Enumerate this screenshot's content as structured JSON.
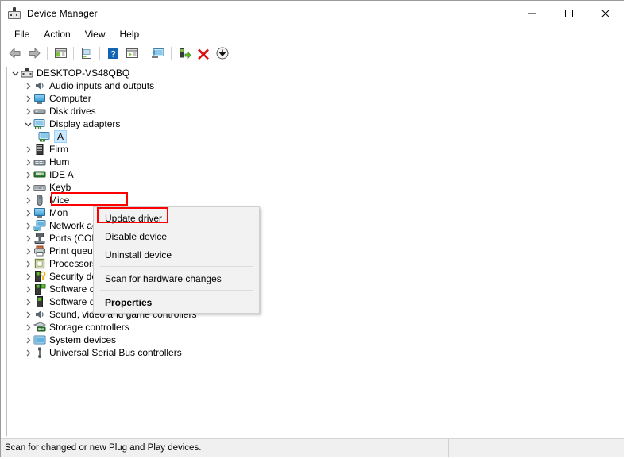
{
  "window": {
    "title": "Device Manager",
    "icon": "device-manager-icon",
    "controls": {
      "minimize": "minimize-icon",
      "maximize": "maximize-icon",
      "close": "close-icon"
    }
  },
  "menubar": {
    "items": [
      {
        "label": "File"
      },
      {
        "label": "Action"
      },
      {
        "label": "View"
      },
      {
        "label": "Help"
      }
    ]
  },
  "toolbar": {
    "buttons": [
      {
        "name": "back-icon"
      },
      {
        "name": "forward-icon"
      },
      {
        "name": "separator"
      },
      {
        "name": "show-hide-console-tree-icon"
      },
      {
        "name": "separator"
      },
      {
        "name": "properties-icon"
      },
      {
        "name": "separator"
      },
      {
        "name": "help-icon"
      },
      {
        "name": "update-driver-icon"
      },
      {
        "name": "separator2"
      },
      {
        "name": "scan-for-hardware-changes-icon"
      },
      {
        "name": "separator"
      },
      {
        "name": "enable-device-icon"
      },
      {
        "name": "uninstall-device-icon"
      },
      {
        "name": "install-legacy-hardware-icon"
      }
    ]
  },
  "tree": {
    "root": {
      "label": "DESKTOP-VS48QBQ",
      "icon": "computer-root-icon",
      "expanded": true
    },
    "items": [
      {
        "label": "Audio inputs and outputs",
        "icon": "speaker-icon",
        "expanded": false,
        "indent": 1
      },
      {
        "label": "Computer",
        "icon": "monitor-icon",
        "expanded": false,
        "indent": 1
      },
      {
        "label": "Disk drives",
        "icon": "disk-icon",
        "expanded": false,
        "indent": 1
      },
      {
        "label": "Display adapters",
        "icon": "display-adapter-icon",
        "expanded": true,
        "indent": 1,
        "highlighted": true
      },
      {
        "label": "A",
        "icon": "display-adapter-icon",
        "expanded": null,
        "indent": 2,
        "selected": true,
        "truncated": true
      },
      {
        "label": "Firm",
        "icon": "firmware-icon",
        "expanded": false,
        "indent": 1,
        "truncated": true
      },
      {
        "label": "Hum",
        "icon": "hid-icon",
        "expanded": false,
        "indent": 1,
        "truncated": true
      },
      {
        "label": "IDE A",
        "icon": "ide-icon",
        "expanded": false,
        "indent": 1,
        "truncated": true
      },
      {
        "label": "Keyb",
        "icon": "keyboard-icon",
        "expanded": false,
        "indent": 1,
        "truncated": true
      },
      {
        "label": "Mice",
        "icon": "mouse-icon",
        "expanded": false,
        "indent": 1,
        "truncated": true
      },
      {
        "label": "Mon",
        "icon": "monitor-icon",
        "expanded": false,
        "indent": 1,
        "truncated": true
      },
      {
        "label": "Network adapters",
        "icon": "network-icon",
        "expanded": false,
        "indent": 1
      },
      {
        "label": "Ports (COM & LPT)",
        "icon": "port-icon",
        "expanded": false,
        "indent": 1
      },
      {
        "label": "Print queues",
        "icon": "printer-icon",
        "expanded": false,
        "indent": 1
      },
      {
        "label": "Processors",
        "icon": "processor-icon",
        "expanded": false,
        "indent": 1
      },
      {
        "label": "Security devices",
        "icon": "security-icon",
        "expanded": false,
        "indent": 1
      },
      {
        "label": "Software components",
        "icon": "software-component-icon",
        "expanded": false,
        "indent": 1
      },
      {
        "label": "Software devices",
        "icon": "software-device-icon",
        "expanded": false,
        "indent": 1
      },
      {
        "label": "Sound, video and game controllers",
        "icon": "speaker-icon",
        "expanded": false,
        "indent": 1
      },
      {
        "label": "Storage controllers",
        "icon": "storage-icon",
        "expanded": false,
        "indent": 1
      },
      {
        "label": "System devices",
        "icon": "system-icon",
        "expanded": false,
        "indent": 1
      },
      {
        "label": "Universal Serial Bus controllers",
        "icon": "usb-icon",
        "expanded": false,
        "indent": 1
      }
    ]
  },
  "context_menu": {
    "items": [
      {
        "label": "Update driver",
        "bold": false,
        "highlighted": true
      },
      {
        "label": "Disable device",
        "bold": false
      },
      {
        "label": "Uninstall device",
        "bold": false
      },
      {
        "separator": true
      },
      {
        "label": "Scan for hardware changes",
        "bold": false
      },
      {
        "separator": true
      },
      {
        "label": "Properties",
        "bold": true
      }
    ]
  },
  "statusbar": {
    "text": "Scan for changed or new Plug and Play devices."
  },
  "colors": {
    "highlight_red": "#ff0000",
    "selection_blue": "#cce8ff",
    "menu_bg": "#f2f2f2",
    "statusbar_bg": "#f0f0f0"
  }
}
